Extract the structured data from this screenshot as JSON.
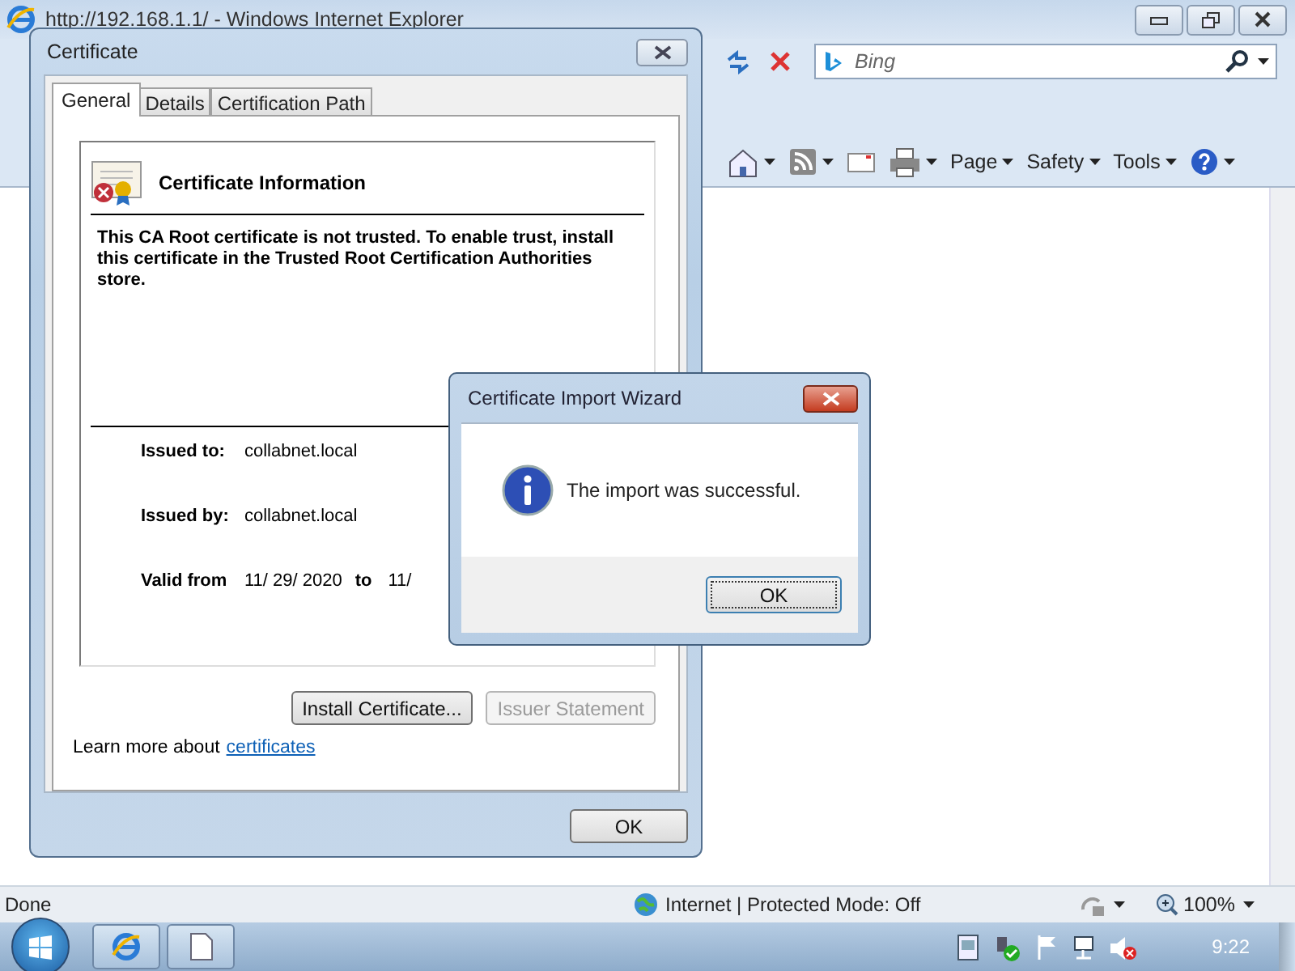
{
  "browser": {
    "title": "http://192.168.1.1/ - Windows Internet Explorer",
    "search": {
      "placeholder": "Bing"
    },
    "command_menus": [
      "Page",
      "Safety",
      "Tools"
    ],
    "status_bar": {
      "text": "Done",
      "zone": "Internet | Protected Mode: Off",
      "zoom": "100%"
    }
  },
  "certificate_dialog": {
    "title": "Certificate",
    "tabs": [
      {
        "label": "General",
        "selected": true
      },
      {
        "label": "Details",
        "selected": false
      },
      {
        "label": "Certification Path",
        "selected": false
      }
    ],
    "info_title": "Certificate Information",
    "message": "This CA Root certificate is not trusted. To enable trust, install this certificate in the Trusted Root Certification Authorities store.",
    "fields": [
      {
        "kind": "pair",
        "label": "Issued to:",
        "value": "collabnet.local"
      },
      {
        "kind": "pair",
        "label": "Issued by:",
        "value": "collabnet.local"
      },
      {
        "kind": "range",
        "label": "Valid from",
        "value": "11/ 29/ 2020",
        "joiner": "to",
        "end": "11/"
      }
    ],
    "buttons": [
      {
        "label": "Install Certificate...",
        "disabled": false
      },
      {
        "label": "Issuer Statement",
        "disabled": true
      }
    ],
    "learn_more": {
      "text": "Learn more about",
      "link": "certificates"
    },
    "ok": "OK"
  },
  "wizard_dialog": {
    "title": "Certificate Import Wizard",
    "message": "The import was successful.",
    "ok": "OK"
  },
  "taskbar": {
    "clock": "9:22"
  }
}
